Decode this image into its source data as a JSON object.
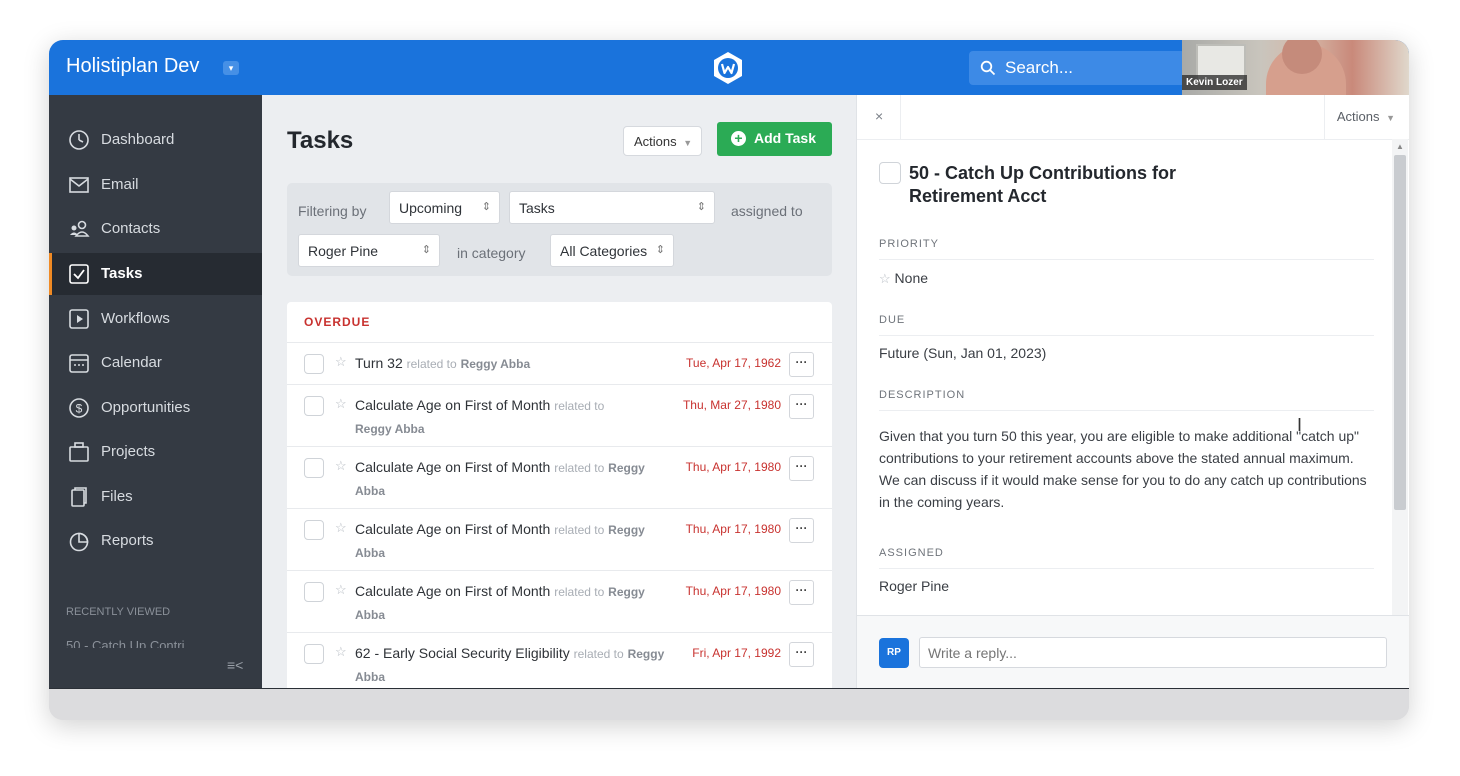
{
  "header": {
    "app_title": "Holistiplan Dev",
    "search_placeholder": "Search...",
    "video_name": "Kevin Lozer"
  },
  "sidebar": {
    "items": [
      {
        "label": "Dashboard",
        "icon": "dashboard-icon"
      },
      {
        "label": "Email",
        "icon": "email-icon"
      },
      {
        "label": "Contacts",
        "icon": "contacts-icon"
      },
      {
        "label": "Tasks",
        "icon": "tasks-icon",
        "active": true
      },
      {
        "label": "Workflows",
        "icon": "workflows-icon"
      },
      {
        "label": "Calendar",
        "icon": "calendar-icon"
      },
      {
        "label": "Opportunities",
        "icon": "opportunities-icon"
      },
      {
        "label": "Projects",
        "icon": "projects-icon"
      },
      {
        "label": "Files",
        "icon": "files-icon"
      },
      {
        "label": "Reports",
        "icon": "reports-icon"
      }
    ],
    "recently_viewed_label": "RECENTLY VIEWED",
    "recent_item": "50 - Catch Up Contri",
    "collapse_symbol": "≡<"
  },
  "tasks": {
    "title": "Tasks",
    "actions_label": "Actions",
    "add_task_label": "Add Task",
    "filter": {
      "filtering_by": "Filtering by",
      "when": "Upcoming",
      "type": "Tasks",
      "assigned_to": "assigned to",
      "assignee": "Roger Pine",
      "in_category": "in category",
      "category": "All Categories"
    },
    "section_label": "OVERDUE",
    "related_to": "related to",
    "rows": [
      {
        "title": "Turn 32",
        "who": "Reggy Abba",
        "date": "Tue, Apr 17, 1962"
      },
      {
        "title": "Calculate Age on First of Month",
        "who": "Reggy Abba",
        "date": "Thu, Mar 27, 1980"
      },
      {
        "title": "Calculate Age on First of Month",
        "who_a": "Reggy",
        "who_b": "Abba",
        "date": "Thu, Apr 17, 1980"
      },
      {
        "title": "Calculate Age on First of Month",
        "who_a": "Reggy",
        "who_b": "Abba",
        "date": "Thu, Apr 17, 1980"
      },
      {
        "title": "Calculate Age on First of Month",
        "who_a": "Reggy",
        "who_b": "Abba",
        "date": "Thu, Apr 17, 1980"
      },
      {
        "title": "62 - Early Social Security Eligibility",
        "who": "Reggy Abba",
        "date": "Fri, Apr 17, 1992"
      }
    ],
    "more_label": "···"
  },
  "detail": {
    "close_label": "×",
    "actions_label": "Actions",
    "title": "50 - Catch Up Contributions for Retirement Acct",
    "priority_label": "PRIORITY",
    "priority_value": "None",
    "due_label": "DUE",
    "due_value": "Future (Sun, Jan 01, 2023)",
    "description_label": "DESCRIPTION",
    "description": "Given that you turn 50 this year, you are eligible to make additional \"catch up\" contributions to your retirement accounts above the stated annual maximum. We can discuss if it would make sense for you to do any catch up contributions in the coming years.",
    "assigned_label": "ASSIGNED",
    "assigned_value": "Roger Pine",
    "reply_avatar": "RP",
    "reply_placeholder": "Write a reply..."
  },
  "colors": {
    "brand_blue": "#1a73dc",
    "sidebar_bg": "#343a43",
    "active_accent": "#f08a24",
    "add_green": "#2bab55",
    "overdue_red": "#c8322f"
  }
}
